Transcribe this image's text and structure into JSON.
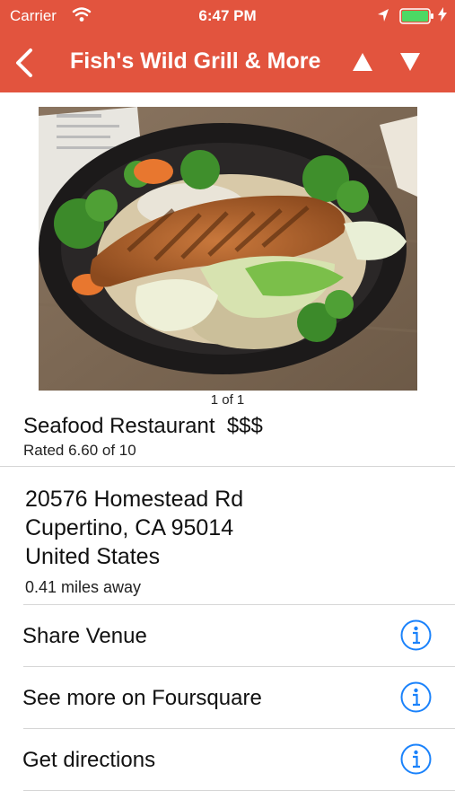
{
  "status_bar": {
    "carrier": "Carrier",
    "time": "6:47 PM",
    "wifi_icon": "wifi-icon",
    "location_icon": "location-arrow-icon",
    "battery_icon": "battery-icon",
    "charging_icon": "charging-bolt-icon"
  },
  "nav": {
    "title": "Fish's Wild Grill & More",
    "back_icon": "chevron-left-icon",
    "up_icon": "triangle-up-icon",
    "down_icon": "triangle-down-icon"
  },
  "photo": {
    "counter": "1 of 1"
  },
  "venue": {
    "category": "Seafood Restaurant",
    "price": "$$$",
    "rating": "Rated 6.60 of 10"
  },
  "address": {
    "line1": "20576 Homestead Rd",
    "line2": "Cupertino, CA 95014",
    "line3": "United States",
    "distance": "0.41 miles away"
  },
  "actions": [
    {
      "label": "Share Venue",
      "icon": "info-icon"
    },
    {
      "label": "See more on Foursquare",
      "icon": "info-icon"
    },
    {
      "label": "Get directions",
      "icon": "info-icon"
    }
  ],
  "colors": {
    "header": "#e2543e",
    "accent": "#1a82fb",
    "separator": "#d6d6d6"
  }
}
